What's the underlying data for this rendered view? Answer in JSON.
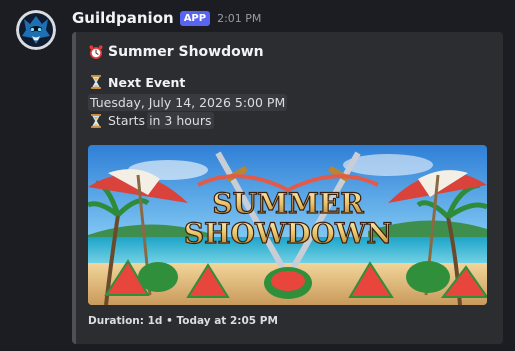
{
  "message": {
    "username": "Guildpanion",
    "badge": "APP",
    "timestamp": "2:01 PM"
  },
  "embed": {
    "title": "Summer Showdown",
    "next_event_label": "Next Event",
    "event_datetime": "Tuesday, July 14, 2026 5:00 PM",
    "starts_label": "Starts",
    "starts_relative": "in 3 hours",
    "banner_text_line1": "SUMMER",
    "banner_text_line2": "SHOWDOWN",
    "footer": "Duration: 1d • Today at 2:05 PM",
    "icons": {
      "title": "alarm-clock-icon",
      "next_event": "hourglass-icon",
      "starts": "hourglass-icon"
    }
  },
  "colors": {
    "background": "#1c1d22",
    "embed_bg": "#2b2d31",
    "badge": "#5865f2",
    "accent_bar": "#4e5058"
  }
}
